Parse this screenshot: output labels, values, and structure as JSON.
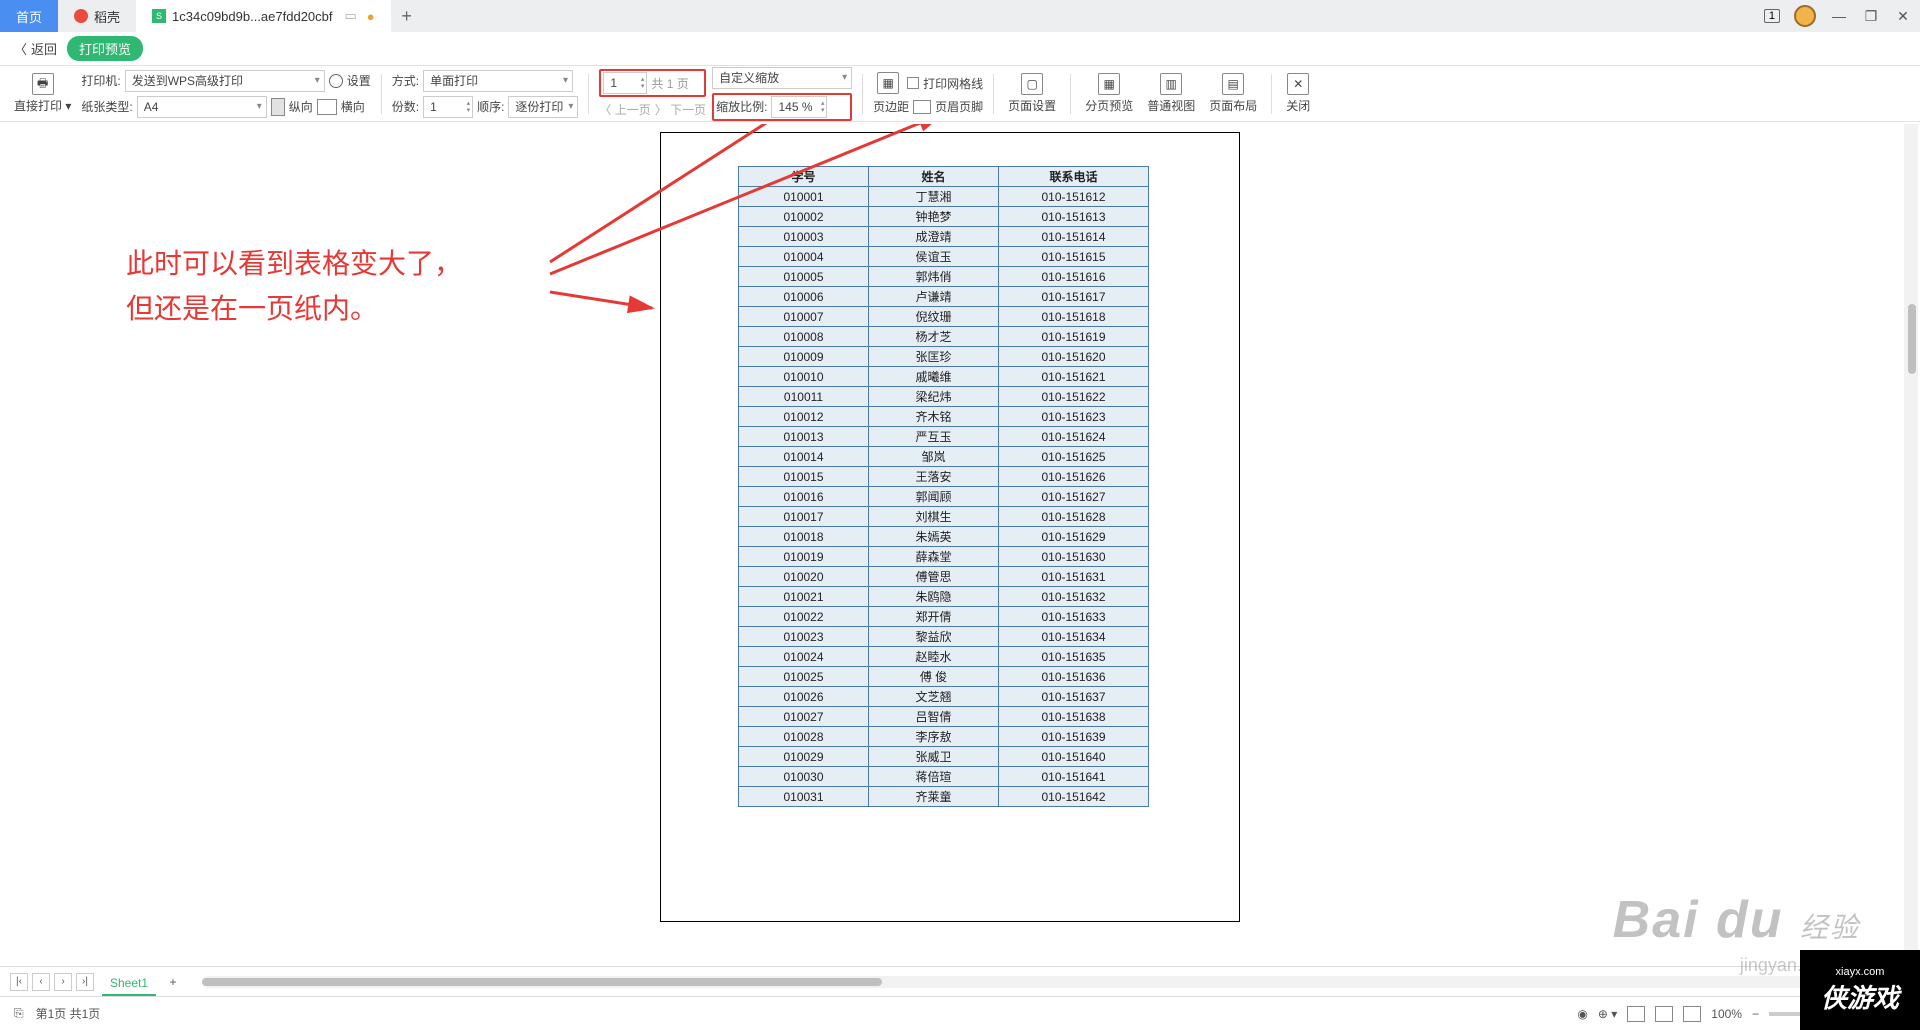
{
  "tabs": {
    "home": "首页",
    "dock": "稻壳",
    "file": "1c34c09bd9b...ae7fdd20cbf"
  },
  "win": {
    "docnum": "1"
  },
  "backbar": {
    "back": "返回",
    "pill": "打印预览"
  },
  "ribbon": {
    "direct_print": "直接打印",
    "printer_lbl": "打印机:",
    "printer_val": "发送到WPS高级打印",
    "paper_lbl": "纸张类型:",
    "paper_val": "A4",
    "settings": "设置",
    "orient_portrait": "纵向",
    "orient_landscape": "横向",
    "mode_lbl": "方式:",
    "mode_val": "单面打印",
    "copies_lbl": "份数:",
    "copies_val": "1",
    "order_lbl": "顺序:",
    "order_val": "逐份打印",
    "page_cur": "1",
    "page_total": "共 1 页",
    "prev_page": "上一页",
    "next_page": "下一页",
    "zoom_mode": "自定义缩放",
    "zoom_lbl": "缩放比例:",
    "zoom_val": "145 %",
    "margins": "页边距",
    "headerfooter": "页眉页脚",
    "pagesetup": "页面设置",
    "pagebreak": "分页预览",
    "normalview": "普通视图",
    "pagelayout": "页面布局",
    "close": "关闭",
    "gridlines": "打印网格线"
  },
  "annot": {
    "l1": "此时可以看到表格变大了，",
    "l2": "但还是在一页纸内。"
  },
  "table": {
    "headers": [
      "学号",
      "姓名",
      "联系电话"
    ],
    "rows": [
      [
        "010001",
        "丁慧湘",
        "010-151612"
      ],
      [
        "010002",
        "钟艳梦",
        "010-151613"
      ],
      [
        "010003",
        "成澄靖",
        "010-151614"
      ],
      [
        "010004",
        "侯谊玉",
        "010-151615"
      ],
      [
        "010005",
        "郭炜俏",
        "010-151616"
      ],
      [
        "010006",
        "卢谦靖",
        "010-151617"
      ],
      [
        "010007",
        "倪纹珊",
        "010-151618"
      ],
      [
        "010008",
        "杨才芝",
        "010-151619"
      ],
      [
        "010009",
        "张匡珍",
        "010-151620"
      ],
      [
        "010010",
        "戚曦维",
        "010-151621"
      ],
      [
        "010011",
        "梁纪炜",
        "010-151622"
      ],
      [
        "010012",
        "齐木铭",
        "010-151623"
      ],
      [
        "010013",
        "严互玉",
        "010-151624"
      ],
      [
        "010014",
        "邹岚",
        "010-151625"
      ],
      [
        "010015",
        "王落安",
        "010-151626"
      ],
      [
        "010016",
        "郭闻顾",
        "010-151627"
      ],
      [
        "010017",
        "刘棋生",
        "010-151628"
      ],
      [
        "010018",
        "朱嫣英",
        "010-151629"
      ],
      [
        "010019",
        "薛森堂",
        "010-151630"
      ],
      [
        "010020",
        "傅管思",
        "010-151631"
      ],
      [
        "010021",
        "朱鸥隐",
        "010-151632"
      ],
      [
        "010022",
        "郑开倩",
        "010-151633"
      ],
      [
        "010023",
        "黎益欣",
        "010-151634"
      ],
      [
        "010024",
        "赵睦水",
        "010-151635"
      ],
      [
        "010025",
        "傅 俊",
        "010-151636"
      ],
      [
        "010026",
        "文芝翘",
        "010-151637"
      ],
      [
        "010027",
        "吕智倩",
        "010-151638"
      ],
      [
        "010028",
        "李序敖",
        "010-151639"
      ],
      [
        "010029",
        "张威卫",
        "010-151640"
      ],
      [
        "010030",
        "蒋倍瑄",
        "010-151641"
      ],
      [
        "010031",
        "齐莱童",
        "010-151642"
      ]
    ]
  },
  "sheet": {
    "name": "Sheet1"
  },
  "status": {
    "page": "第1页 共1页",
    "zoom": "100%"
  },
  "wm": {
    "brand": "Bai",
    "brand2": "经验",
    "sub": "jingyan.baidu.c",
    "game": "游戏",
    "gameurl": "xiayx.com"
  }
}
